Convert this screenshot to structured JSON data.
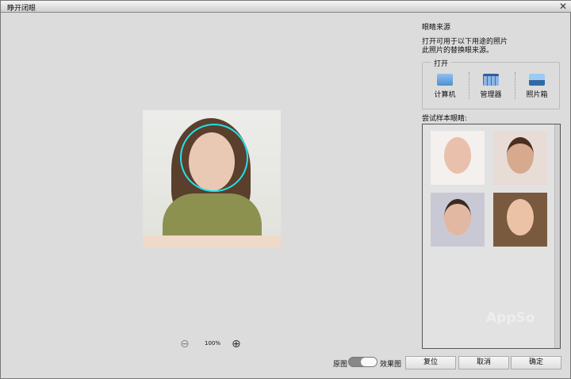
{
  "window": {
    "title": "睁开闭眼",
    "close": "✕"
  },
  "preview": {
    "zoom_level": "100%"
  },
  "right": {
    "heading": "眼睛来源",
    "desc1": "打开可用于以下用途的照片",
    "desc2": "此照片的替换眼来源。",
    "open_group": "打开",
    "options": [
      {
        "label": "计算机",
        "icon": "folder-icon"
      },
      {
        "label": "管理器",
        "icon": "organizer-icon"
      },
      {
        "label": "照片箱",
        "icon": "photo-box-icon"
      }
    ],
    "samples_label": "尝试样本眼睛:"
  },
  "footer": {
    "original": "原图",
    "effect": "效果图",
    "reset": "复位",
    "cancel": "取消",
    "ok": "确定"
  },
  "watermark": "AppSo"
}
